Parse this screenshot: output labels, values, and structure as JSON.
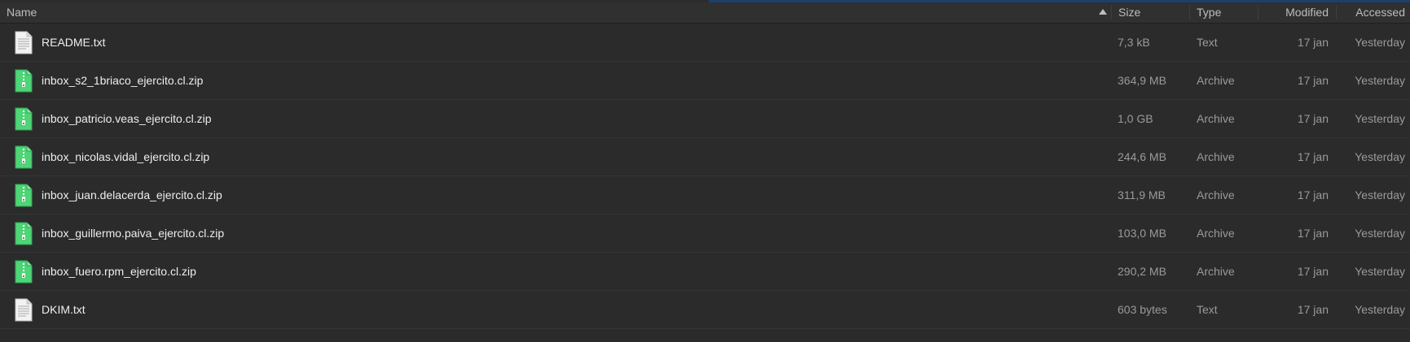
{
  "columns": {
    "name": "Name",
    "size": "Size",
    "type": "Type",
    "modified": "Modified",
    "accessed": "Accessed"
  },
  "files": [
    {
      "name": "README.txt",
      "size": "7,3 kB",
      "type": "Text",
      "modified": "17 jan",
      "accessed": "Yesterday",
      "icon": "text-file-icon"
    },
    {
      "name": "inbox_s2_1briaco_ejercito.cl.zip",
      "size": "364,9 MB",
      "type": "Archive",
      "modified": "17 jan",
      "accessed": "Yesterday",
      "icon": "archive-file-icon"
    },
    {
      "name": "inbox_patricio.veas_ejercito.cl.zip",
      "size": "1,0 GB",
      "type": "Archive",
      "modified": "17 jan",
      "accessed": "Yesterday",
      "icon": "archive-file-icon"
    },
    {
      "name": "inbox_nicolas.vidal_ejercito.cl.zip",
      "size": "244,6 MB",
      "type": "Archive",
      "modified": "17 jan",
      "accessed": "Yesterday",
      "icon": "archive-file-icon"
    },
    {
      "name": "inbox_juan.delacerda_ejercito.cl.zip",
      "size": "311,9 MB",
      "type": "Archive",
      "modified": "17 jan",
      "accessed": "Yesterday",
      "icon": "archive-file-icon"
    },
    {
      "name": "inbox_guillermo.paiva_ejercito.cl.zip",
      "size": "103,0 MB",
      "type": "Archive",
      "modified": "17 jan",
      "accessed": "Yesterday",
      "icon": "archive-file-icon"
    },
    {
      "name": "inbox_fuero.rpm_ejercito.cl.zip",
      "size": "290,2 MB",
      "type": "Archive",
      "modified": "17 jan",
      "accessed": "Yesterday",
      "icon": "archive-file-icon"
    },
    {
      "name": "DKIM.txt",
      "size": "603 bytes",
      "type": "Text",
      "modified": "17 jan",
      "accessed": "Yesterday",
      "icon": "text-file-icon"
    }
  ],
  "colors": {
    "background": "#2b2b2b",
    "archive_icon": "#4fd476",
    "text_icon": "#f2f2f2",
    "progress": "#1c3f6e"
  }
}
